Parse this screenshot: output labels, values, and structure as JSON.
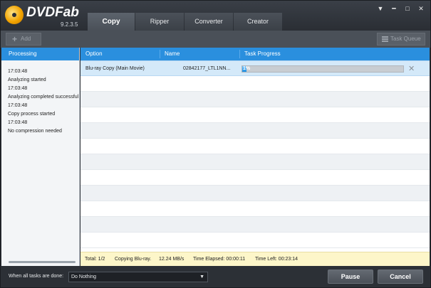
{
  "app": {
    "logo_text": "DVDFab",
    "version": "9.2.3.5"
  },
  "tabs": [
    {
      "label": "Copy",
      "active": true
    },
    {
      "label": "Ripper",
      "active": false
    },
    {
      "label": "Converter",
      "active": false
    },
    {
      "label": "Creator",
      "active": false
    }
  ],
  "window_controls": {
    "menu": "▼",
    "minimize": "━",
    "maximize": "□",
    "close": "✕"
  },
  "toolbar": {
    "add_label": "Add",
    "task_queue_label": "Task Queue"
  },
  "left_panel": {
    "header": "Processing",
    "log": [
      "17:03:48",
      "Analyzing started",
      "17:03:48",
      "Analyzing completed successfully",
      "17:03:48",
      "Copy process started",
      "17:03:48",
      "No compression needed"
    ]
  },
  "table": {
    "columns": [
      "Option",
      "Name",
      "Task Progress"
    ],
    "rows": [
      {
        "option": "Blu-ray Copy (Main Movie)",
        "name": "02842177_LTL1NN...",
        "progress_text": "1%",
        "progress": 0.01
      }
    ]
  },
  "status": {
    "total": "Total: 1/2",
    "action": "Copying Blu-ray.",
    "speed": "12.24 MB/s",
    "elapsed": "Time Elapsed: 00:00:11",
    "left": "Time Left: 00:23:14"
  },
  "bottom": {
    "when_done_label": "When all tasks are done:",
    "when_done_value": "Do Nothing",
    "pause_label": "Pause",
    "cancel_label": "Cancel"
  },
  "colors": {
    "accent": "#2a8fde",
    "selected_row": "#d4e9f9",
    "status_bar": "#fdf6c9",
    "chrome": "#2b2f36"
  }
}
